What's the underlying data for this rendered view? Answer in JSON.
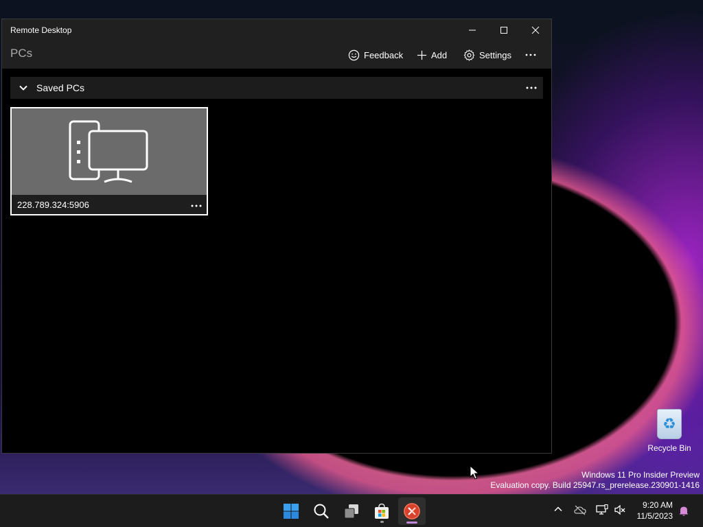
{
  "window": {
    "title": "Remote Desktop",
    "minimize_icon": "minimize-icon",
    "maximize_icon": "maximize-icon",
    "close_icon": "close-icon"
  },
  "command_bar": {
    "page_title": "PCs",
    "feedback_label": "Feedback",
    "add_label": "Add",
    "settings_label": "Settings"
  },
  "group": {
    "label": "Saved PCs"
  },
  "pcs": [
    {
      "name": "228.789.324:5906",
      "icon": "desktop-pc-icon"
    }
  ],
  "desktop": {
    "recycle_bin_label": "Recycle Bin",
    "watermark_line1": "Windows 11 Pro Insider Preview",
    "watermark_line2": "Evaluation copy. Build 25947.rs_prerelease.230901-1416"
  },
  "taskbar": {
    "apps": [
      "start-icon",
      "search-icon",
      "task-view-icon",
      "store-icon",
      "remote-desktop-icon"
    ],
    "time": "9:20 AM",
    "date": "11/5/2023"
  },
  "colors": {
    "window_bg": "#000000",
    "chrome_bg": "#202020",
    "tile_thumb_bg": "#6b6b6b",
    "accent_active": "#c08ad8"
  }
}
